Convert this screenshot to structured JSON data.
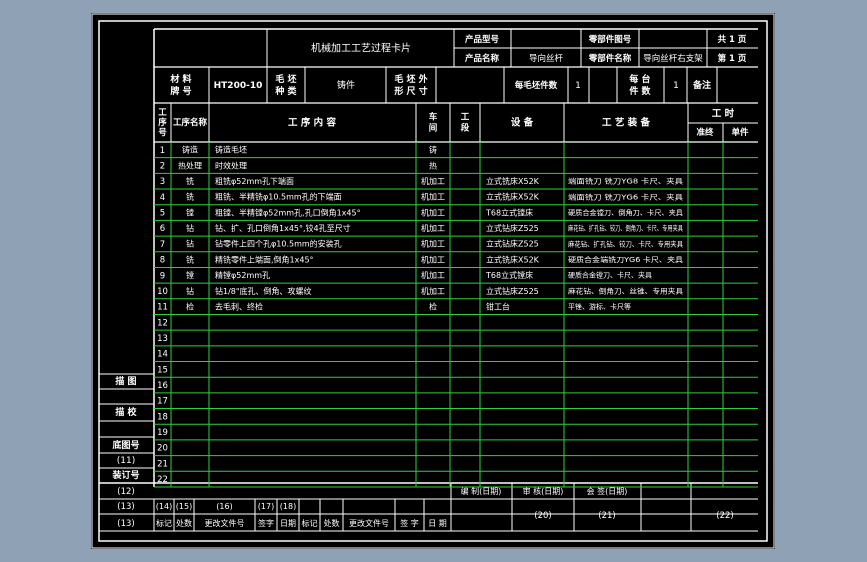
{
  "header": {
    "title": "机械加工工艺过程卡片",
    "product_model_label": "产品型号",
    "product_name_label": "产品名称",
    "product_name_value": "导向丝杆",
    "part_drawing_no_label": "零部件图号",
    "part_name_label": "零部件名称",
    "part_name_value": "导向丝杆右支架",
    "total_pages": "共 1 页",
    "page_no": "第 1 页"
  },
  "material_row": {
    "material_no_label": "材 料\n牌 号",
    "material_no_value": "HT200-10",
    "blank_type_label": "毛 坯\n种 类",
    "blank_type_value": "铸件",
    "blank_dims_label": "毛 坯 外\n形 尺 寸",
    "pieces_per_blank_label": "每毛坯件数",
    "pieces_per_blank_value": "1",
    "per_unit_label": "每 台\n件 数",
    "per_unit_value": "1",
    "remark_label": "备注"
  },
  "columns": {
    "op_no": "工\n序\n号",
    "op_name": "工序名称",
    "op_content": "工 序 内 容",
    "workshop": "车\n间",
    "section": "工\n段",
    "equipment": "设 备",
    "tooling": "工 艺 装 备",
    "hours": "工 时",
    "prep": "准终",
    "unit": "单件"
  },
  "rows": [
    {
      "no": "1",
      "name": "铸造",
      "content": "铸造毛坯",
      "shop": "铸",
      "equip": "",
      "tool": ""
    },
    {
      "no": "2",
      "name": "热处理",
      "content": "时效处理",
      "shop": "热",
      "equip": "",
      "tool": ""
    },
    {
      "no": "3",
      "name": "铣",
      "content": "粗铣φ52mm孔下端面",
      "shop": "机加工",
      "equip": "立式铣床X52K",
      "tool": "端面铣刀 铣刀YG8 卡尺、夹具"
    },
    {
      "no": "4",
      "name": "铣",
      "content": "粗铣、半精铣φ10.5mm孔的下端面",
      "shop": "机加工",
      "equip": "立式铣床X52K",
      "tool": "端面铣刀 铣刀YG6 卡尺、夹具"
    },
    {
      "no": "5",
      "name": "镗",
      "content": "粗镗、半精镗φ52mm孔,孔口倒角1x45°",
      "shop": "机加工",
      "equip": "T68立式镗床",
      "tool": "硬质合金镗刀、倒角刀、卡尺、夹具"
    },
    {
      "no": "6",
      "name": "钻",
      "content": "钻、扩、孔口倒角1x45°,铰4孔至尺寸",
      "shop": "机加工",
      "equip": "立式钻床Z525",
      "tool": "麻花钻、扩孔钻、铰刀、倒角刀、卡尺、专用夹具"
    },
    {
      "no": "7",
      "name": "钻",
      "content": "钻零件上四个孔φ10.5mm的安装孔",
      "shop": "机加工",
      "equip": "立式钻床Z525",
      "tool": "麻花钻、扩孔钻、铰刀、卡尺、专用夹具"
    },
    {
      "no": "8",
      "name": "铣",
      "content": "精铣零件上端面,倒角1x45°",
      "shop": "机加工",
      "equip": "立式铣床X52K",
      "tool": "硬质合金端铣刀YG6 卡尺、夹具"
    },
    {
      "no": "9",
      "name": "镗",
      "content": "精镗φ52mm孔",
      "shop": "机加工",
      "equip": "T68立式镗床",
      "tool": "硬质合金镗刀、卡尺、夹具"
    },
    {
      "no": "10",
      "name": "钻",
      "content": "钻1/8\"底孔、倒角、攻螺纹",
      "shop": "机加工",
      "equip": "立式钻床Z525",
      "tool": "麻花钻、倒角刀、丝锥、专用夹具"
    },
    {
      "no": "11",
      "name": "检",
      "content": "去毛刺、终检",
      "shop": "检",
      "equip": "钳工台",
      "tool": "平锉、游标、卡尺等"
    },
    {
      "no": "12",
      "name": "",
      "content": "",
      "shop": "",
      "equip": "",
      "tool": ""
    },
    {
      "no": "13",
      "name": "",
      "content": "",
      "shop": "",
      "equip": "",
      "tool": ""
    },
    {
      "no": "14",
      "name": "",
      "content": "",
      "shop": "",
      "equip": "",
      "tool": ""
    },
    {
      "no": "15",
      "name": "",
      "content": "",
      "shop": "",
      "equip": "",
      "tool": ""
    },
    {
      "no": "16",
      "name": "",
      "content": "",
      "shop": "",
      "equip": "",
      "tool": ""
    },
    {
      "no": "17",
      "name": "",
      "content": "",
      "shop": "",
      "equip": "",
      "tool": ""
    },
    {
      "no": "18",
      "name": "",
      "content": "",
      "shop": "",
      "equip": "",
      "tool": ""
    },
    {
      "no": "19",
      "name": "",
      "content": "",
      "shop": "",
      "equip": "",
      "tool": ""
    },
    {
      "no": "20",
      "name": "",
      "content": "",
      "shop": "",
      "equip": "",
      "tool": ""
    },
    {
      "no": "21",
      "name": "",
      "content": "",
      "shop": "",
      "equip": "",
      "tool": ""
    },
    {
      "no": "22",
      "name": "",
      "content": "",
      "shop": "",
      "equip": "",
      "tool": ""
    }
  ],
  "side_labels": {
    "trace": "描 图",
    "proof": "描 校",
    "base_drawing": "底图号",
    "base_code": "(11)",
    "binding": "装订号"
  },
  "footer": {
    "r1_code": "(12)",
    "r2_code": "(13)",
    "r3_code": "(13)",
    "codes": [
      "(14)",
      "(15)",
      "(16)",
      "(17)",
      "(18)"
    ],
    "labels": [
      "标记",
      "处数",
      "更改文件号",
      "签字",
      "日期",
      "标记",
      "处数",
      "更改文件号",
      "签 字",
      "日 期"
    ],
    "compile": "编 制(日期)",
    "review": "审 核(日期)",
    "sign": "会 签(日期)",
    "code20": "(20)",
    "code21": "(21)",
    "code22": "(22)"
  }
}
